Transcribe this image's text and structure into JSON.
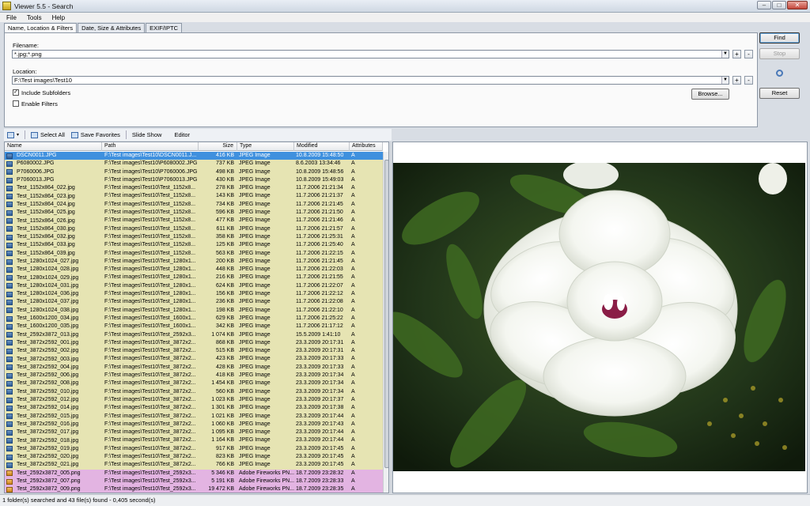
{
  "window": {
    "title": "Viewer 5.5 - Search"
  },
  "menu": [
    "File",
    "Tools",
    "Help"
  ],
  "tabs": [
    "Name, Location & Filters",
    "Date, Size & Attributes",
    "EXIF/IPTC"
  ],
  "form": {
    "filename_label": "Filename:",
    "filename_value": "*.jpg;*.png",
    "location_label": "Location:",
    "location_value": "F:\\Test images\\Test10",
    "include_subfolders": "Include Subfolders",
    "enable_filters": "Enable Filters",
    "browse": "Browse...",
    "plus": "+",
    "minus": "-"
  },
  "buttons": {
    "find": "Find",
    "stop": "Stop",
    "reset": "Reset"
  },
  "toolbar": {
    "select_all": "Select All",
    "save_favorites": "Save Favorites",
    "slide_show": "Slide Show",
    "editor": "Editor"
  },
  "columns": [
    "Name",
    "Path",
    "Size",
    "Type",
    "Modified",
    "Attributes"
  ],
  "files": [
    {
      "name": "DSCN0011.JPG",
      "path": "F:\\Test images\\Test10\\DSCN0011.J...",
      "size": "416 KB",
      "type": "JPEG Image",
      "modified": "10.8.2009 15:48:50",
      "attr": "A",
      "sel": true
    },
    {
      "name": "P6080002.JPG",
      "path": "F:\\Test images\\Test10\\P6080002.JPG",
      "size": "737 KB",
      "type": "JPEG Image",
      "modified": "8.6.2003 13:34:46",
      "attr": "A"
    },
    {
      "name": "P7060006.JPG",
      "path": "F:\\Test images\\Test10\\P7060006.JPG",
      "size": "498 KB",
      "type": "JPEG Image",
      "modified": "10.8.2009 15:48:56",
      "attr": "A"
    },
    {
      "name": "P7060013.JPG",
      "path": "F:\\Test images\\Test10\\P7060013.JPG",
      "size": "430 KB",
      "type": "JPEG Image",
      "modified": "10.8.2009 15:49:03",
      "attr": "A"
    },
    {
      "name": "Test_1152x864_022.jpg",
      "path": "F:\\Test images\\Test10\\Test_1152x8...",
      "size": "278 KB",
      "type": "JPEG Image",
      "modified": "11.7.2006 21:21:34",
      "attr": "A"
    },
    {
      "name": "Test_1152x864_023.jpg",
      "path": "F:\\Test images\\Test10\\Test_1152x8...",
      "size": "143 KB",
      "type": "JPEG Image",
      "modified": "11.7.2006 21:21:37",
      "attr": "A"
    },
    {
      "name": "Test_1152x864_024.jpg",
      "path": "F:\\Test images\\Test10\\Test_1152x8...",
      "size": "734 KB",
      "type": "JPEG Image",
      "modified": "11.7.2006 21:21:45",
      "attr": "A"
    },
    {
      "name": "Test_1152x864_025.jpg",
      "path": "F:\\Test images\\Test10\\Test_1152x8...",
      "size": "596 KB",
      "type": "JPEG Image",
      "modified": "11.7.2006 21:21:50",
      "attr": "A"
    },
    {
      "name": "Test_1152x864_026.jpg",
      "path": "F:\\Test images\\Test10\\Test_1152x8...",
      "size": "477 KB",
      "type": "JPEG Image",
      "modified": "11.7.2006 21:21:46",
      "attr": "A"
    },
    {
      "name": "Test_1152x864_030.jpg",
      "path": "F:\\Test images\\Test10\\Test_1152x8...",
      "size": "611 KB",
      "type": "JPEG Image",
      "modified": "11.7.2006 21:21:57",
      "attr": "A"
    },
    {
      "name": "Test_1152x864_032.jpg",
      "path": "F:\\Test images\\Test10\\Test_1152x8...",
      "size": "358 KB",
      "type": "JPEG Image",
      "modified": "11.7.2006 21:25:31",
      "attr": "A"
    },
    {
      "name": "Test_1152x864_033.jpg",
      "path": "F:\\Test images\\Test10\\Test_1152x8...",
      "size": "125 KB",
      "type": "JPEG Image",
      "modified": "11.7.2006 21:25:40",
      "attr": "A"
    },
    {
      "name": "Test_1152x864_039.jpg",
      "path": "F:\\Test images\\Test10\\Test_1152x8...",
      "size": "563 KB",
      "type": "JPEG Image",
      "modified": "11.7.2006 21:22:15",
      "attr": "A"
    },
    {
      "name": "Test_1280x1024_027.jpg",
      "path": "F:\\Test images\\Test10\\Test_1280x1...",
      "size": "200 KB",
      "type": "JPEG Image",
      "modified": "11.7.2006 21:21:45",
      "attr": "A"
    },
    {
      "name": "Test_1280x1024_028.jpg",
      "path": "F:\\Test images\\Test10\\Test_1280x1...",
      "size": "448 KB",
      "type": "JPEG Image",
      "modified": "11.7.2006 21:22:03",
      "attr": "A"
    },
    {
      "name": "Test_1280x1024_029.jpg",
      "path": "F:\\Test images\\Test10\\Test_1280x1...",
      "size": "216 KB",
      "type": "JPEG Image",
      "modified": "11.7.2006 21:21:55",
      "attr": "A"
    },
    {
      "name": "Test_1280x1024_031.jpg",
      "path": "F:\\Test images\\Test10\\Test_1280x1...",
      "size": "624 KB",
      "type": "JPEG Image",
      "modified": "11.7.2006 21:22:07",
      "attr": "A"
    },
    {
      "name": "Test_1280x1024_036.jpg",
      "path": "F:\\Test images\\Test10\\Test_1280x1...",
      "size": "156 KB",
      "type": "JPEG Image",
      "modified": "11.7.2006 21:22:12",
      "attr": "A"
    },
    {
      "name": "Test_1280x1024_037.jpg",
      "path": "F:\\Test images\\Test10\\Test_1280x1...",
      "size": "236 KB",
      "type": "JPEG Image",
      "modified": "11.7.2006 21:22:08",
      "attr": "A"
    },
    {
      "name": "Test_1280x1024_038.jpg",
      "path": "F:\\Test images\\Test10\\Test_1280x1...",
      "size": "198 KB",
      "type": "JPEG Image",
      "modified": "11.7.2006 21:22:10",
      "attr": "A"
    },
    {
      "name": "Test_1600x1200_034.jpg",
      "path": "F:\\Test images\\Test10\\Test_1600x1...",
      "size": "629 KB",
      "type": "JPEG Image",
      "modified": "11.7.2006 21:25:22",
      "attr": "A"
    },
    {
      "name": "Test_1600x1200_035.jpg",
      "path": "F:\\Test images\\Test10\\Test_1600x1...",
      "size": "342 KB",
      "type": "JPEG Image",
      "modified": "11.7.2006 21:17:12",
      "attr": "A"
    },
    {
      "name": "Test_2592x3872_013.jpg",
      "path": "F:\\Test images\\Test10\\Test_2592x3...",
      "size": "1 074 KB",
      "type": "JPEG Image",
      "modified": "15.5.2009 1:41:10",
      "attr": "A"
    },
    {
      "name": "Test_3872x2592_001.jpg",
      "path": "F:\\Test images\\Test10\\Test_3872x2...",
      "size": "868 KB",
      "type": "JPEG Image",
      "modified": "23.3.2009 20:17:31",
      "attr": "A"
    },
    {
      "name": "Test_3872x2592_002.jpg",
      "path": "F:\\Test images\\Test10\\Test_3872x2...",
      "size": "515 KB",
      "type": "JPEG Image",
      "modified": "23.3.2009 20:17:31",
      "attr": "A"
    },
    {
      "name": "Test_3872x2592_003.jpg",
      "path": "F:\\Test images\\Test10\\Test_3872x2...",
      "size": "423 KB",
      "type": "JPEG Image",
      "modified": "23.3.2009 20:17:33",
      "attr": "A"
    },
    {
      "name": "Test_3872x2592_004.jpg",
      "path": "F:\\Test images\\Test10\\Test_3872x2...",
      "size": "428 KB",
      "type": "JPEG Image",
      "modified": "23.3.2009 20:17:33",
      "attr": "A"
    },
    {
      "name": "Test_3872x2592_006.jpg",
      "path": "F:\\Test images\\Test10\\Test_3872x2...",
      "size": "418 KB",
      "type": "JPEG Image",
      "modified": "23.3.2009 20:17:34",
      "attr": "A"
    },
    {
      "name": "Test_3872x2592_008.jpg",
      "path": "F:\\Test images\\Test10\\Test_3872x2...",
      "size": "1 454 KB",
      "type": "JPEG Image",
      "modified": "23.3.2009 20:17:34",
      "attr": "A"
    },
    {
      "name": "Test_3872x2592_010.jpg",
      "path": "F:\\Test images\\Test10\\Test_3872x2...",
      "size": "560 KB",
      "type": "JPEG Image",
      "modified": "23.3.2009 20:17:34",
      "attr": "A"
    },
    {
      "name": "Test_3872x2592_012.jpg",
      "path": "F:\\Test images\\Test10\\Test_3872x2...",
      "size": "1 023 KB",
      "type": "JPEG Image",
      "modified": "23.3.2009 20:17:37",
      "attr": "A"
    },
    {
      "name": "Test_3872x2592_014.jpg",
      "path": "F:\\Test images\\Test10\\Test_3872x2...",
      "size": "1 301 KB",
      "type": "JPEG Image",
      "modified": "23.3.2009 20:17:38",
      "attr": "A"
    },
    {
      "name": "Test_3872x2592_015.jpg",
      "path": "F:\\Test images\\Test10\\Test_3872x2...",
      "size": "1 021 KB",
      "type": "JPEG Image",
      "modified": "23.3.2009 20:17:44",
      "attr": "A"
    },
    {
      "name": "Test_3872x2592_016.jpg",
      "path": "F:\\Test images\\Test10\\Test_3872x2...",
      "size": "1 060 KB",
      "type": "JPEG Image",
      "modified": "23.3.2009 20:17:43",
      "attr": "A"
    },
    {
      "name": "Test_3872x2592_017.jpg",
      "path": "F:\\Test images\\Test10\\Test_3872x2...",
      "size": "1 095 KB",
      "type": "JPEG Image",
      "modified": "23.3.2009 20:17:44",
      "attr": "A"
    },
    {
      "name": "Test_3872x2592_018.jpg",
      "path": "F:\\Test images\\Test10\\Test_3872x2...",
      "size": "1 164 KB",
      "type": "JPEG Image",
      "modified": "23.3.2009 20:17:44",
      "attr": "A"
    },
    {
      "name": "Test_3872x2592_019.jpg",
      "path": "F:\\Test images\\Test10\\Test_3872x2...",
      "size": "917 KB",
      "type": "JPEG Image",
      "modified": "23.3.2009 20:17:45",
      "attr": "A"
    },
    {
      "name": "Test_3872x2592_020.jpg",
      "path": "F:\\Test images\\Test10\\Test_3872x2...",
      "size": "823 KB",
      "type": "JPEG Image",
      "modified": "23.3.2009 20:17:45",
      "attr": "A"
    },
    {
      "name": "Test_3872x2592_021.jpg",
      "path": "F:\\Test images\\Test10\\Test_3872x2...",
      "size": "766 KB",
      "type": "JPEG Image",
      "modified": "23.3.2009 20:17:45",
      "attr": "A"
    },
    {
      "name": "Test_2592x3872_005.png",
      "path": "F:\\Test images\\Test10\\Test_2592x3...",
      "size": "5 346 KB",
      "type": "Adobe Fireworks PN...",
      "modified": "18.7.2009 23:28:32",
      "attr": "A",
      "png": true
    },
    {
      "name": "Test_2592x3872_007.png",
      "path": "F:\\Test images\\Test10\\Test_2592x3...",
      "size": "5 191 KB",
      "type": "Adobe Fireworks PN...",
      "modified": "18.7.2009 23:28:33",
      "attr": "A",
      "png": true
    },
    {
      "name": "Test_2592x3872_009.png",
      "path": "F:\\Test images\\Test10\\Test_2592x3...",
      "size": "19 472 KB",
      "type": "Adobe Fireworks PN...",
      "modified": "18.7.2009 23:28:35",
      "attr": "A",
      "png": true
    }
  ],
  "status": "1 folder(s) searched and 43 file(s) found - 0,405 second(s)",
  "colors": {
    "jpg_row": "#e6e4b3",
    "png_row": "#e3b4e2",
    "selected_row": "#3f90de"
  }
}
